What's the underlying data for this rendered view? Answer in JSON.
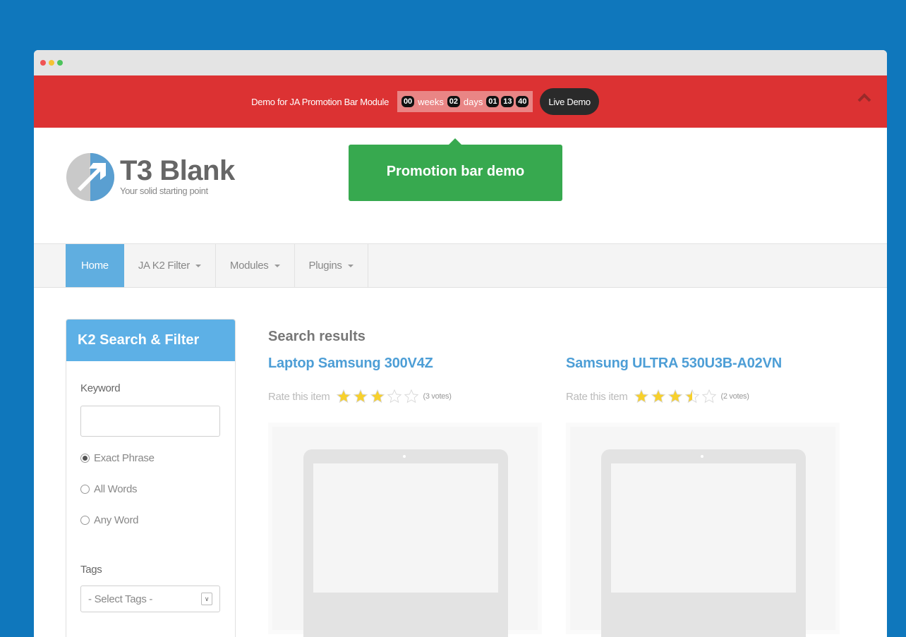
{
  "window": {
    "dot_colors": [
      "#f05454",
      "#f5c233",
      "#4cc35b"
    ]
  },
  "promo_bar": {
    "text": "Demo for JA Promotion Bar Module",
    "countdown": {
      "weeks": "00",
      "weeks_label": "weeks",
      "days": "02",
      "days_label": "days",
      "hours": "01",
      "minutes": "13",
      "seconds": "40"
    },
    "live_demo_label": "Live Demo",
    "tooltip": "Promotion bar demo"
  },
  "brand": {
    "title": "T3 Blank",
    "tagline": "Your solid starting point"
  },
  "nav": {
    "items": [
      {
        "label": "Home",
        "active": true,
        "dropdown": false
      },
      {
        "label": "JA K2 Filter",
        "active": false,
        "dropdown": true
      },
      {
        "label": "Modules",
        "active": false,
        "dropdown": true
      },
      {
        "label": "Plugins",
        "active": false,
        "dropdown": true
      }
    ]
  },
  "filter": {
    "title": "K2 Search & Filter",
    "keyword_label": "Keyword",
    "keyword_value": "",
    "match_options": [
      {
        "label": "Exact Phrase",
        "checked": true
      },
      {
        "label": "All Words",
        "checked": false
      },
      {
        "label": "Any Word",
        "checked": false
      }
    ],
    "tags_label": "Tags",
    "tags_select": "- Select Tags -"
  },
  "results": {
    "heading": "Search results",
    "items": [
      {
        "title": "Laptop Samsung 300V4Z",
        "rate_label": "Rate this item",
        "rating": 3,
        "votes": "(3 votes)"
      },
      {
        "title": "Samsung ULTRA 530U3B-A02VN",
        "rate_label": "Rate this item",
        "rating": 3.5,
        "votes": "(2 votes)"
      }
    ]
  }
}
